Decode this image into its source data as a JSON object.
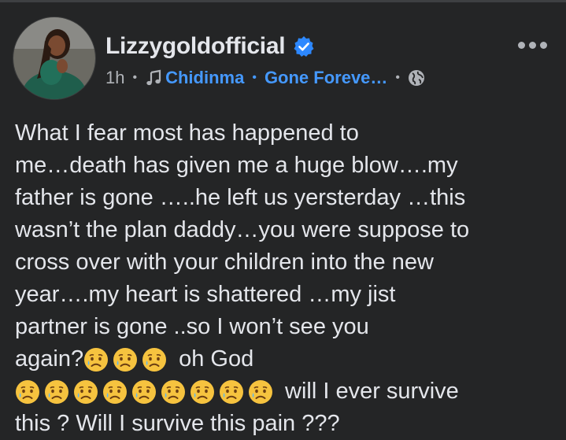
{
  "post": {
    "author": "Lizzygoldofficial",
    "time": "1h",
    "music_artist": "Chidinma",
    "music_song": "Gone Foreve…",
    "separator": "•",
    "icons": {
      "verified": "verified-badge-icon",
      "music": "music-note-icon",
      "audience": "globe-icon",
      "more": "more-options-icon"
    },
    "colors": {
      "background": "#242526",
      "text": "#e4e6eb",
      "secondary": "#b0b3b8",
      "link": "#4599ff",
      "verified": "#2d88ff"
    },
    "body_lines": [
      "What I fear most has happened to",
      "me…death has given me a huge blow….my",
      "father is gone …..he left us yersterday …this",
      "wasn’t the plan daddy…you were suppose to",
      "cross over with your children into the new",
      "year….my heart is shattered …my jist",
      "partner is gone ..so I won’t see you",
      "again?"
    ],
    "line8_tail": "oh God",
    "line9_tail": "will I ever survive",
    "line10": "this ? Will I survive this pain ???",
    "emoji_name": "sad-but-relieved-face-emoji"
  }
}
